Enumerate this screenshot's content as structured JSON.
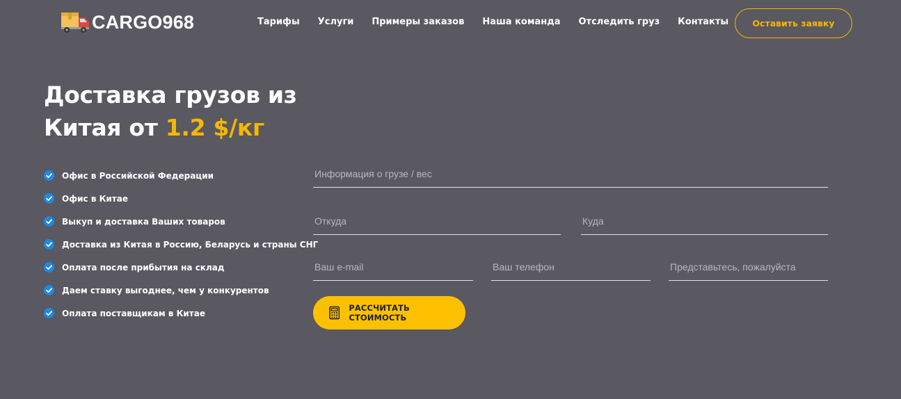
{
  "brand": {
    "logo_text": "CARGO968"
  },
  "nav": {
    "items": [
      {
        "label": "Тарифы"
      },
      {
        "label": "Услуги"
      },
      {
        "label": "Примеры заказов"
      },
      {
        "label": "Наша команда"
      },
      {
        "label": "Отследить груз"
      },
      {
        "label": "Контакты"
      }
    ],
    "cta_label": "Оставить заявку"
  },
  "hero": {
    "title_line1": "Доставка грузов из",
    "title_line2_prefix": "Китая от ",
    "title_line2_accent": "1.2 $/кг"
  },
  "features": [
    {
      "label": "Офис в Российской Федерации"
    },
    {
      "label": "Офис в Китае"
    },
    {
      "label": "Выкуп и доставка Ваших товаров"
    },
    {
      "label": "Доставка из Китая в Россию, Беларусь и страны СНГ"
    },
    {
      "label": "Оплата после прибытия на склад"
    },
    {
      "label": "Даем ставку выгоднее, чем у конкурентов"
    },
    {
      "label": "Оплата поставщикам в Китае"
    }
  ],
  "form": {
    "cargo_info": {
      "placeholder": "Информация о грузе / вес",
      "value": ""
    },
    "from": {
      "placeholder": "Откуда",
      "value": ""
    },
    "to": {
      "placeholder": "Куда",
      "value": ""
    },
    "email": {
      "placeholder": "Ваш e-mail",
      "value": ""
    },
    "phone": {
      "placeholder": "Ваш телефон",
      "value": ""
    },
    "name": {
      "placeholder": "Представьтесь, пожалуйста",
      "value": ""
    },
    "submit_label": "РАССЧИТАТЬ СТОИМОСТЬ"
  },
  "icons": {
    "logo": "truck-icon",
    "feature": "check-circle-icon",
    "submit": "calculator-icon"
  },
  "colors": {
    "background": "#5a5861",
    "accent": "#f5b700",
    "button": "#fcc000",
    "check": "#1e88e5"
  }
}
